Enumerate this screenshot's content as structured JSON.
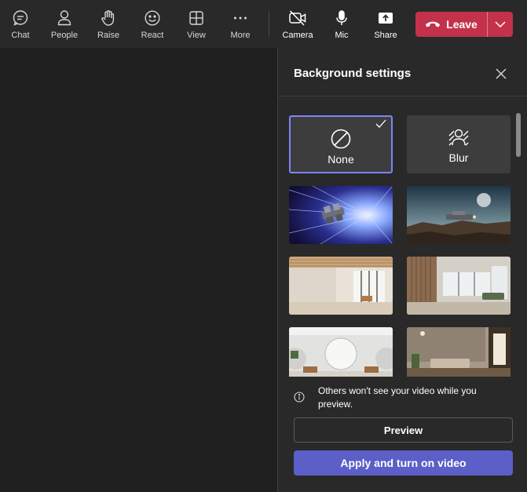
{
  "toolbar": {
    "chat": "Chat",
    "people": "People",
    "raise": "Raise",
    "react": "React",
    "view": "View",
    "more": "More",
    "camera": "Camera",
    "mic": "Mic",
    "share": "Share",
    "leave": "Leave"
  },
  "panel": {
    "title": "Background settings",
    "options": [
      {
        "label": "None",
        "icon": "none-icon",
        "selected": true
      },
      {
        "label": "Blur",
        "icon": "blur-icon",
        "selected": false
      }
    ],
    "backgrounds": [
      "space-warp-spaceship",
      "alien-landscape-spaceship",
      "bright-minimal-room",
      "modern-living-room",
      "round-arch-room",
      "cozy-lounge-room"
    ],
    "info": "Others won't see your video while you preview.",
    "preview_button": "Preview",
    "apply_button": "Apply and turn on video"
  },
  "colors": {
    "leave": "#c4314b",
    "accent": "#5b5fc7",
    "selected_border": "#7f85f5"
  }
}
